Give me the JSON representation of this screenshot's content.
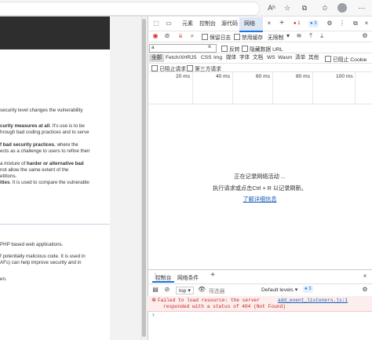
{
  "browser": {
    "icons": [
      "read-aloud-icon",
      "favorite-icon",
      "collections-icon",
      "favorites-bar-icon",
      "profile-icon",
      "more-icon"
    ],
    "read_aloud_label": "Aʰ"
  },
  "page": {
    "lines": [
      {
        "text": "security level changes the vulnerability",
        "bold": false
      },
      {
        "text": "curity measures at all",
        "bold": true,
        "rest": ". It's use is to be"
      },
      {
        "text": "hrough bad coding practices and to serve",
        "bold": false
      },
      {
        "text": "f bad security practices",
        "bold": true,
        "rest": ", where the"
      },
      {
        "text": "ects as a challenge to users to refine their",
        "bold": false
      },
      {
        "text": "a mixture of ",
        "bold": false,
        "bold_part": "harder or alternative bad"
      },
      {
        "text": "not allow the same extent of the",
        "bold": false
      },
      {
        "text": "etitions.",
        "bold": false
      },
      {
        "text": "ities",
        "bold": true,
        "rest": ". It is used to compare the vulnerable"
      },
      {
        "text": "PHP based web applications.",
        "bold": false
      },
      {
        "text": "f potentially malicious code. It is used in",
        "bold": false
      },
      {
        "text": "AFs) can help improve security and in",
        "bold": false
      },
      {
        "text": "en.",
        "bold": false
      }
    ]
  },
  "devtools": {
    "tabs": [
      "元素",
      "控制台",
      "源代码",
      "网络"
    ],
    "active_tab": "网络",
    "error_badge": "1",
    "info_badge": "3",
    "toolbar": {
      "preserve_log": "保留日志",
      "disable_cache": "禁用缓存",
      "throttle": "无限制"
    },
    "filter": {
      "value": "a",
      "invert": "反转",
      "hide_data_urls": "隐藏数据 URL"
    },
    "types": [
      "全部",
      "Fetch/XHR",
      "JS",
      "CSS",
      "Img",
      "媒体",
      "字体",
      "文档",
      "WS",
      "Wasm",
      "清单",
      "其他"
    ],
    "blocked_cookies": "已阻止 Cookie",
    "blocked_requests": "已阻止请求",
    "third_party": "第三方请求",
    "timeline_ticks": [
      "20 ms",
      "40 ms",
      "60 ms",
      "80 ms",
      "100 ms"
    ],
    "empty": {
      "line1": "正在记录网络活动 ...",
      "line2": "执行请求或点击Ctrl + R 以记录刷新。",
      "link": "了解详细信息"
    },
    "drawer": {
      "tabs": [
        "控制台",
        "网络条件"
      ],
      "context": "top",
      "filter_placeholder": "筛选器",
      "levels": "Default levels",
      "levels_badge": "3",
      "error_line1": "Failed to load resource: the server",
      "error_line2": "responded with a status of 404 (Not Found)",
      "error_source": "add_event_listeners.js:1"
    }
  },
  "colors": {
    "accent": "#1a73e8",
    "error": "#c5221f",
    "hero": "#2e2e2e"
  }
}
